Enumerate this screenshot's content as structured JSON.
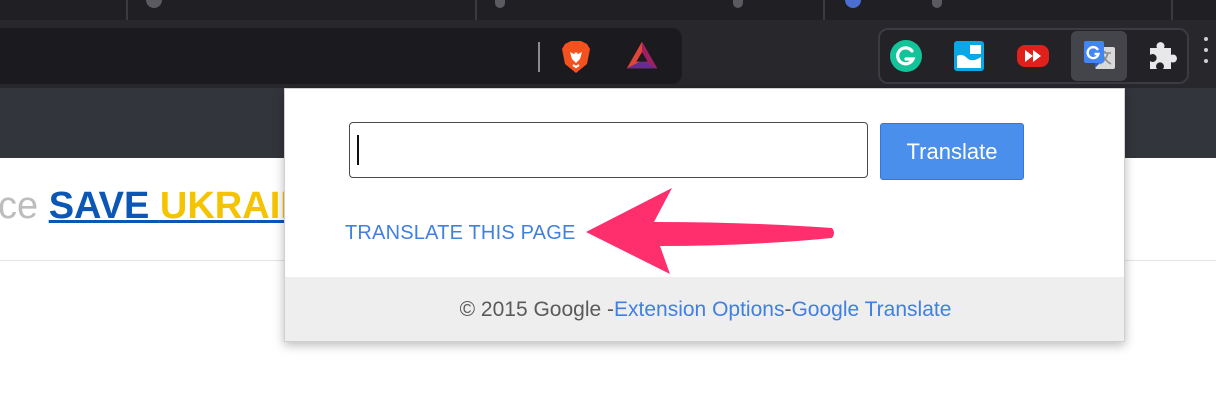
{
  "browser": {
    "extensions": [
      "grammarly-icon",
      "window-extension-icon",
      "youtube-forward-icon",
      "google-translate-icon",
      "puzzle-icon"
    ]
  },
  "page": {
    "banner_prefix": "ce ",
    "banner_save": "SAVE ",
    "banner_ukraine": "UKRAINE"
  },
  "popup": {
    "input_value": "",
    "translate_button": "Translate",
    "translate_page_link": "TRANSLATE THIS PAGE",
    "footer": {
      "copyright": "© 2015 Google - ",
      "options_link": "Extension Options",
      "separator": " - ",
      "translate_link": "Google Translate"
    }
  },
  "colors": {
    "accent_blue": "#4a8fec",
    "link_blue": "#3f80e0",
    "arrow_pink": "#ff2e6d",
    "ukraine_blue": "#0b57b6",
    "ukraine_yellow": "#f5c400"
  }
}
